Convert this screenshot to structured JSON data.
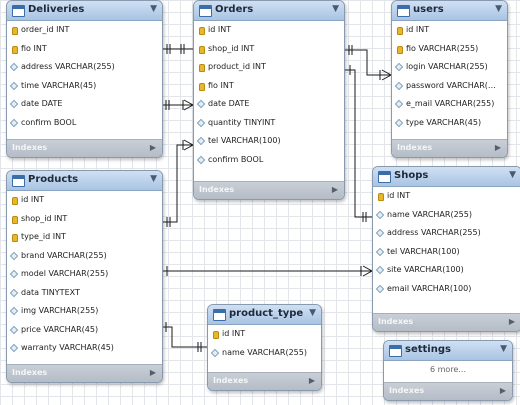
{
  "tables": [
    {
      "id": "deliveries",
      "name": "Deliveries",
      "footer": "Indexes",
      "collapse_icon": "triangle-down-icon",
      "columns": [
        {
          "text": "order_id INT",
          "icon": "key"
        },
        {
          "text": "fio INT",
          "icon": "key"
        },
        {
          "text": "address VARCHAR(255)",
          "icon": "diamond"
        },
        {
          "text": "time VARCHAR(45)",
          "icon": "diamond"
        },
        {
          "text": "date DATE",
          "icon": "diamond"
        },
        {
          "text": "confirm BOOL",
          "icon": "diamond"
        }
      ]
    },
    {
      "id": "orders",
      "name": "Orders",
      "footer": "Indexes",
      "collapse_icon": "triangle-down-icon",
      "columns": [
        {
          "text": "id INT",
          "icon": "key"
        },
        {
          "text": "shop_id INT",
          "icon": "key"
        },
        {
          "text": "product_id INT",
          "icon": "key"
        },
        {
          "text": "fio INT",
          "icon": "key"
        },
        {
          "text": "date DATE",
          "icon": "diamond"
        },
        {
          "text": "quantity TINYINT",
          "icon": "diamond"
        },
        {
          "text": "tel VARCHAR(100)",
          "icon": "diamond"
        },
        {
          "text": "confirm BOOL",
          "icon": "diamond"
        }
      ]
    },
    {
      "id": "users",
      "name": "users",
      "footer": "Indexes",
      "collapse_icon": "triangle-down-icon",
      "columns": [
        {
          "text": "id INT",
          "icon": "key"
        },
        {
          "text": "fio VARCHAR(255)",
          "icon": "key"
        },
        {
          "text": "login VARCHAR(255)",
          "icon": "diamond"
        },
        {
          "text": "password VARCHAR(…",
          "icon": "diamond"
        },
        {
          "text": "e_mail VARCHAR(255)",
          "icon": "diamond"
        },
        {
          "text": "type VARCHAR(45)",
          "icon": "diamond"
        }
      ]
    },
    {
      "id": "products",
      "name": "Products",
      "footer": "Indexes",
      "collapse_icon": "triangle-down-icon",
      "columns": [
        {
          "text": "id INT",
          "icon": "key"
        },
        {
          "text": "shop_id INT",
          "icon": "key"
        },
        {
          "text": "type_id INT",
          "icon": "key"
        },
        {
          "text": "brand VARCHAR(255)",
          "icon": "diamond"
        },
        {
          "text": "model VARCHAR(255)",
          "icon": "diamond"
        },
        {
          "text": "data TINYTEXT",
          "icon": "diamond"
        },
        {
          "text": "img VARCHAR(255)",
          "icon": "diamond"
        },
        {
          "text": "price VARCHAR(45)",
          "icon": "diamond"
        },
        {
          "text": "warranty VARCHAR(45)",
          "icon": "diamond"
        }
      ]
    },
    {
      "id": "shops",
      "name": "Shops",
      "footer": "Indexes",
      "collapse_icon": "triangle-down-icon",
      "columns": [
        {
          "text": "id INT",
          "icon": "key"
        },
        {
          "text": "name VARCHAR(255)",
          "icon": "diamond"
        },
        {
          "text": "address VARCHAR(255)",
          "icon": "diamond"
        },
        {
          "text": "tel VARCHAR(100)",
          "icon": "diamond"
        },
        {
          "text": "site VARCHAR(100)",
          "icon": "diamond"
        },
        {
          "text": "email VARCHAR(100)",
          "icon": "diamond"
        }
      ]
    },
    {
      "id": "product_type",
      "name": "product_type",
      "footer": "Indexes",
      "collapse_icon": "triangle-down-icon",
      "columns": [
        {
          "text": "id INT",
          "icon": "key"
        },
        {
          "text": "name VARCHAR(255)",
          "icon": "diamond"
        }
      ]
    },
    {
      "id": "settings",
      "name": "settings",
      "footer": "Indexes",
      "collapse_icon": "triangle-down-icon",
      "more_label": "6 more...",
      "columns": []
    }
  ]
}
